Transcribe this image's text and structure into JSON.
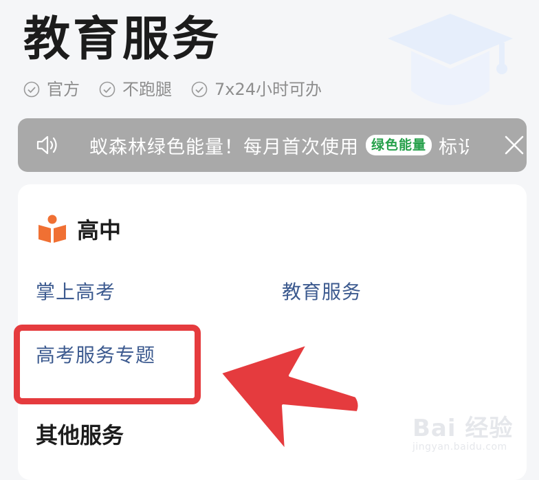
{
  "header": {
    "title": "教育服务",
    "features": [
      "官方",
      "不跑腿",
      "7x24小时可办"
    ]
  },
  "notice": {
    "text_before": "蚁森林绿色能量！每月首次使用",
    "badge": "绿色能量",
    "text_after": "标识的"
  },
  "section": {
    "title": "高中",
    "links": [
      "掌上高考",
      "教育服务",
      "高考服务专题"
    ]
  },
  "other_section": {
    "title": "其他服务"
  },
  "watermark": {
    "logo": "Bai 经验",
    "url": "jingyan.baidu.com"
  },
  "colors": {
    "annotation_red": "#e53b3e",
    "link_blue": "#3c5a8f",
    "notice_gray": "#a9a9a9",
    "badge_green": "#25a04a",
    "book_orange": "#f07033"
  },
  "icons": [
    "graduation-cap-icon",
    "check-circle-icon",
    "speaker-icon",
    "close-icon",
    "book-icon",
    "arrow-icon"
  ]
}
